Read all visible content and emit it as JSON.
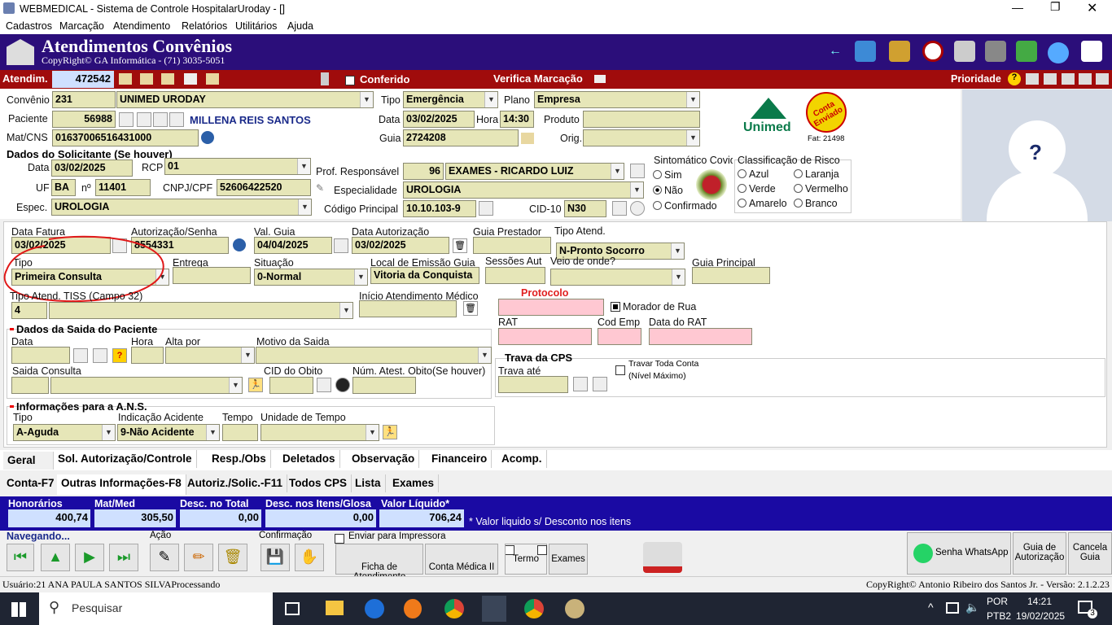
{
  "window": {
    "title": "WEBMEDICAL - Sistema de Controle HospitalarUroday - []"
  },
  "menu": [
    "Cadastros",
    "Marcação",
    "Atendimento",
    "Relatórios",
    "Utilitários",
    "Ajuda"
  ],
  "header": {
    "title": "Atendimentos Convênios",
    "subtitle": "CopyRight© GA Informática - (71) 3035-5051"
  },
  "redbar": {
    "atendim_label": "Atendim.",
    "atendim_value": "472542",
    "conferido": "Conferido",
    "verifica": "Verifica Marcação",
    "prioridade": "Prioridade"
  },
  "patient": {
    "convenio_label": "Convênio",
    "convenio_code": "231",
    "convenio_name": "UNIMED URODAY",
    "tipo_label": "Tipo",
    "tipo": "Emergência",
    "plano_label": "Plano",
    "plano": "Empresa",
    "paciente_label": "Paciente",
    "paciente_code": "56988",
    "paciente_name": "MILLENA REIS SANTOS",
    "data_label": "Data",
    "data": "03/02/2025",
    "hora_label": "Hora",
    "hora": "14:30",
    "produto_label": "Produto",
    "matcns_label": "Mat/CNS",
    "matcns": "01637006516431000",
    "guia_label": "Guia",
    "guia": "2724208",
    "orig_label": "Orig.",
    "unimed": "Unimed",
    "conta_enviado": "Conta Enviado",
    "fat": "Fat: 21498"
  },
  "solicitante": {
    "title": "Dados do Solicitante (Se houver)",
    "data_label": "Data",
    "data": "03/02/2025",
    "rcp_label": "RCP",
    "rcp": "01",
    "uf_label": "UF",
    "uf": "BA",
    "n_label": "nº",
    "n": "11401",
    "cnpj_label": "CNPJ/CPF",
    "cnpj": "52606422520",
    "espec_label": "Espec.",
    "espec": "UROLOGIA",
    "prof_label": "Prof. Responsável",
    "prof_code": "96",
    "prof_name": "EXAMES - RICARDO LUIZ",
    "especialidade_label": "Especialidade",
    "especialidade": "UROLOGIA",
    "codprinc_label": "Código Principal",
    "codprinc": "10.10.103-9",
    "cid_label": "CID-10",
    "cid": "N30"
  },
  "sintomatico": {
    "title": "Sintomático Covid",
    "options": [
      "Sim",
      "Não",
      "Confirmado"
    ]
  },
  "risco": {
    "title": "Classificação de Risco",
    "options": [
      "Azul",
      "Laranja",
      "Verde",
      "Vermelho",
      "Amarelo",
      "Branco"
    ]
  },
  "fatura": {
    "datafat_label": "Data Fatura",
    "datafat": "03/02/2025",
    "aut_label": "Autorização/Senha",
    "aut": "8554331",
    "valguia_label": "Val. Guia",
    "valguia": "04/04/2025",
    "dataaut_label": "Data Autorização",
    "dataaut": "03/02/2025",
    "guiaprest_label": "Guia Prestador",
    "tipoatend_label": "Tipo Atend.",
    "tipoatend": "N-Pronto Socorro",
    "tipo_label": "Tipo",
    "tipo": "Primeira Consulta",
    "entrega_label": "Entrega",
    "situacao_label": "Situação",
    "situacao": "0-Normal",
    "localem_label": "Local de Emissão Guia",
    "localem": "Vitoria da Conquista",
    "sessoes_label": "Sessões Aut",
    "veio_label": "Veio de onde?",
    "guiaprinc_label": "Guia Principal",
    "tiss_label": "Tipo Atend. TISS (Campo 32)",
    "tiss": "4",
    "inicio_label": "Início Atendimento Médico",
    "protocolo_label": "Protocolo",
    "morador": "Morador de Rua",
    "rat_label": "RAT",
    "codemp_label": "Cod Emp",
    "datarat_label": "Data do RAT"
  },
  "saida": {
    "title": "Dados da Saida do Paciente",
    "data_label": "Data",
    "hora_label": "Hora",
    "alta_label": "Alta por",
    "motivo_label": "Motivo da Saida",
    "saidacons_label": "Saida Consulta",
    "cidobito_label": "CID do Obito",
    "numatest_label": "Núm. Atest. Obito(Se houver)"
  },
  "cps": {
    "title": "Trava da CPS",
    "trava_label": "Trava até",
    "travar": "Travar Toda Conta",
    "nivel": "(Nível Máximo)"
  },
  "ans": {
    "title": "Informações para a A.N.S.",
    "tipo_label": "Tipo",
    "tipo": "A-Aguda",
    "indic_label": "Indicação Acidente",
    "indic": "9-Não Acidente",
    "tempo_label": "Tempo",
    "unid_label": "Unidade de Tempo"
  },
  "tabs1": [
    "Geral",
    "Sol. Autorização/Controle",
    "Resp./Obs",
    "Deletados",
    "Observação",
    "Financeiro",
    "Acomp."
  ],
  "tabs2": [
    "Conta-F7",
    "Outras Informações-F8",
    "Autoriz./Solic.-F11",
    "Todos CPS",
    "Lista",
    "Exames"
  ],
  "totals": {
    "honor_label": "Honorários",
    "honor": "400,74",
    "mat_label": "Mat/Med",
    "mat": "305,50",
    "desc_label": "Desc. no Total",
    "desc": "0,00",
    "descit_label": "Desc. nos Itens/Glosa",
    "descit": "0,00",
    "liq_label": "Valor Líquido*",
    "liq": "706,24",
    "note": "* Valor liquido s/ Desconto nos itens"
  },
  "footer": {
    "navegando": "Navegando...",
    "acao": "Ação",
    "confirmacao": "Confirmação",
    "enviar": "Enviar para Impressora",
    "ficha": "Ficha de Atendimento",
    "conta": "Conta Médica II",
    "termo": "Termo",
    "exames": "Exames",
    "senha": "Senha WhatsApp",
    "guia_aut": "Guia de Autorização",
    "cancela": "Cancela Guia"
  },
  "status": {
    "user": "Usuário:21 ANA PAULA SANTOS SILVAProcessando",
    "copy": "CopyRight© Antonio Ribeiro dos Santos Jr. - Versão: 2.1.2.23"
  },
  "taskbar": {
    "search": "Pesquisar",
    "lang": "POR",
    "lang2": "PTB2",
    "time": "14:21",
    "date": "19/02/2025",
    "notif": "3"
  }
}
